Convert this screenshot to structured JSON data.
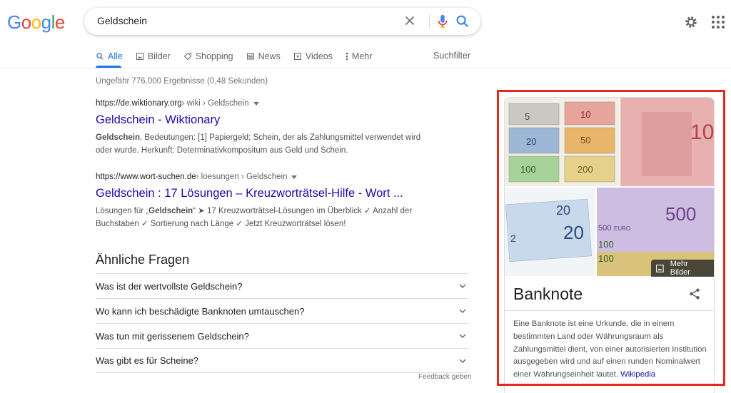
{
  "logo": {
    "letters": [
      "G",
      "o",
      "o",
      "g",
      "l",
      "e"
    ],
    "colors": [
      "#4285f4",
      "#ea4335",
      "#fbbc05",
      "#4285f4",
      "#34a853",
      "#ea4335"
    ]
  },
  "search": {
    "query": "Geldschein"
  },
  "tabs": [
    {
      "label": "Alle",
      "icon": "search-icon",
      "active": true
    },
    {
      "label": "Bilder",
      "icon": "image-icon"
    },
    {
      "label": "Shopping",
      "icon": "tag-icon"
    },
    {
      "label": "News",
      "icon": "news-icon"
    },
    {
      "label": "Videos",
      "icon": "video-icon"
    },
    {
      "label": "Mehr",
      "icon": "more-icon"
    }
  ],
  "suchfilter": "Suchfilter",
  "stats": "Ungefähr 776.000 Ergebnisse (0,48 Sekunden)",
  "results": [
    {
      "domain": "https://de.wiktionary.org",
      "path": " › wiki › Geldschein",
      "title": "Geldschein - Wiktionary",
      "snippet_bold": "Geldschein",
      "snippet": ". Bedeutungen: [1] Papiergeld; Schein, der als Zahlungsmittel verwendet wird oder wurde. Herkunft: Determinativkompositum aus Geld und Schein."
    },
    {
      "domain": "https://www.wort-suchen.de",
      "path": " › loesungen › Geldschein",
      "title": "Geldschein : 17 Lösungen – Kreuzworträtsel-Hilfe - Wort ...",
      "snippet_pre": "Lösungen für „",
      "snippet_bold": "Geldschein",
      "snippet": "“ ➤ 17 Kreuzworträtsel-Lösungen im Überblick ✓ Anzahl der Buchstaben ✓ Sortierung nach Länge ✓ Jetzt Kreuzworträtsel lösen!"
    }
  ],
  "paa": {
    "title": "Ähnliche Fragen",
    "items": [
      "Was ist der wertvollste Geldschein?",
      "Wo kann ich beschädigte Banknoten umtauschen?",
      "Was tun mit gerissenem Geldschein?",
      "Was gibt es für Scheine?"
    ],
    "feedback": "Feedback geben"
  },
  "knowledge_panel": {
    "title": "Banknote",
    "more_images": "Mehr Bilder",
    "description": "Eine Banknote ist eine Urkunde, die in einem bestimmten Land oder Währungsraum als Zahlungsmittel dient, von einer autorisierten Institution ausgegeben wird und auf einen runden Nominalwert einer Währungseinheit lautet.",
    "source": "Wikipedia",
    "note_labels": {
      "a": [
        "5",
        "10",
        "20",
        "50",
        "100",
        "200"
      ],
      "b": "10",
      "c": [
        "20",
        "20",
        "2"
      ],
      "d": [
        "500",
        "500",
        "100",
        "100"
      ],
      "euro": "EURO"
    },
    "highlight_color": "#e8281d"
  }
}
